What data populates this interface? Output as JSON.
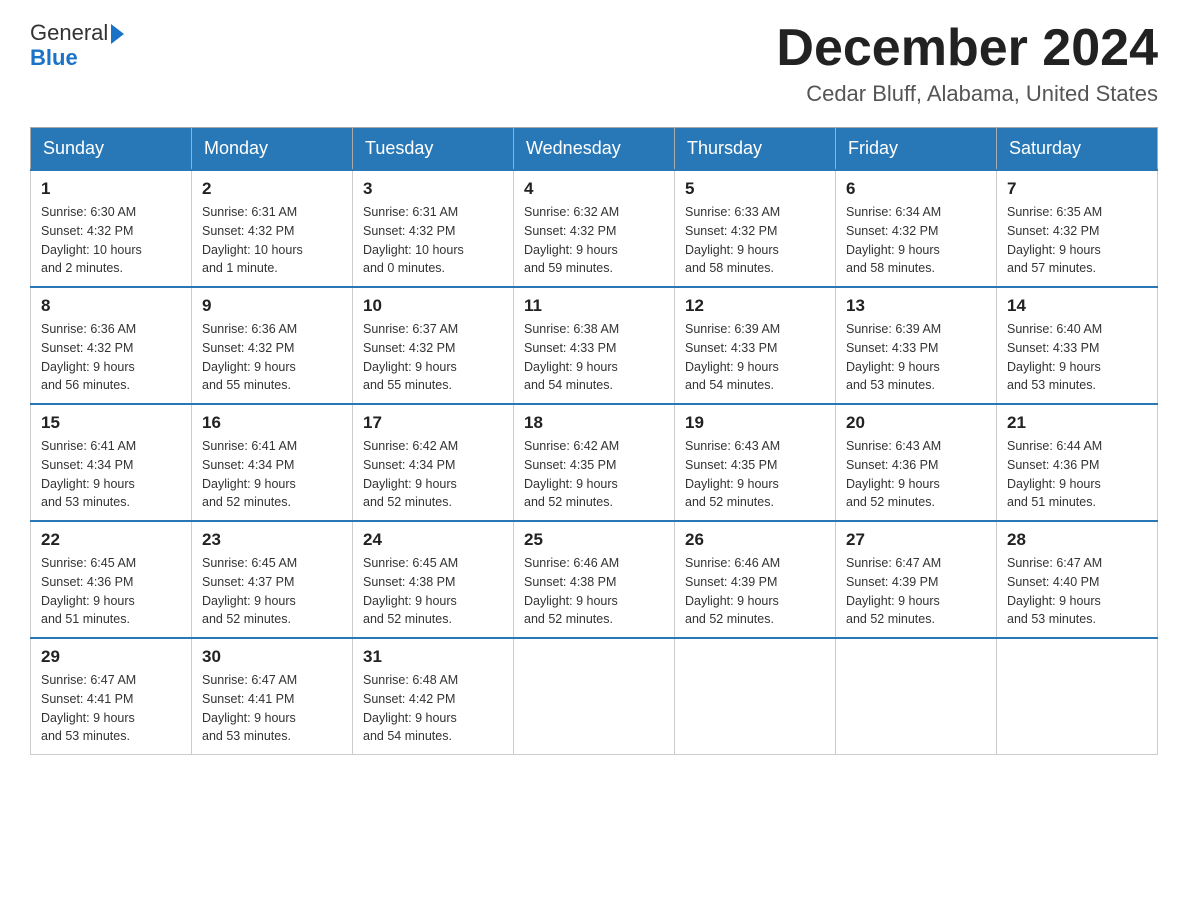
{
  "header": {
    "logo_general": "General",
    "logo_blue": "Blue",
    "month_title": "December 2024",
    "location": "Cedar Bluff, Alabama, United States"
  },
  "days_of_week": [
    "Sunday",
    "Monday",
    "Tuesday",
    "Wednesday",
    "Thursday",
    "Friday",
    "Saturday"
  ],
  "weeks": [
    [
      {
        "day": "1",
        "sunrise": "6:30 AM",
        "sunset": "4:32 PM",
        "daylight": "10 hours and 2 minutes."
      },
      {
        "day": "2",
        "sunrise": "6:31 AM",
        "sunset": "4:32 PM",
        "daylight": "10 hours and 1 minute."
      },
      {
        "day": "3",
        "sunrise": "6:31 AM",
        "sunset": "4:32 PM",
        "daylight": "10 hours and 0 minutes."
      },
      {
        "day": "4",
        "sunrise": "6:32 AM",
        "sunset": "4:32 PM",
        "daylight": "9 hours and 59 minutes."
      },
      {
        "day": "5",
        "sunrise": "6:33 AM",
        "sunset": "4:32 PM",
        "daylight": "9 hours and 58 minutes."
      },
      {
        "day": "6",
        "sunrise": "6:34 AM",
        "sunset": "4:32 PM",
        "daylight": "9 hours and 58 minutes."
      },
      {
        "day": "7",
        "sunrise": "6:35 AM",
        "sunset": "4:32 PM",
        "daylight": "9 hours and 57 minutes."
      }
    ],
    [
      {
        "day": "8",
        "sunrise": "6:36 AM",
        "sunset": "4:32 PM",
        "daylight": "9 hours and 56 minutes."
      },
      {
        "day": "9",
        "sunrise": "6:36 AM",
        "sunset": "4:32 PM",
        "daylight": "9 hours and 55 minutes."
      },
      {
        "day": "10",
        "sunrise": "6:37 AM",
        "sunset": "4:32 PM",
        "daylight": "9 hours and 55 minutes."
      },
      {
        "day": "11",
        "sunrise": "6:38 AM",
        "sunset": "4:33 PM",
        "daylight": "9 hours and 54 minutes."
      },
      {
        "day": "12",
        "sunrise": "6:39 AM",
        "sunset": "4:33 PM",
        "daylight": "9 hours and 54 minutes."
      },
      {
        "day": "13",
        "sunrise": "6:39 AM",
        "sunset": "4:33 PM",
        "daylight": "9 hours and 53 minutes."
      },
      {
        "day": "14",
        "sunrise": "6:40 AM",
        "sunset": "4:33 PM",
        "daylight": "9 hours and 53 minutes."
      }
    ],
    [
      {
        "day": "15",
        "sunrise": "6:41 AM",
        "sunset": "4:34 PM",
        "daylight": "9 hours and 53 minutes."
      },
      {
        "day": "16",
        "sunrise": "6:41 AM",
        "sunset": "4:34 PM",
        "daylight": "9 hours and 52 minutes."
      },
      {
        "day": "17",
        "sunrise": "6:42 AM",
        "sunset": "4:34 PM",
        "daylight": "9 hours and 52 minutes."
      },
      {
        "day": "18",
        "sunrise": "6:42 AM",
        "sunset": "4:35 PM",
        "daylight": "9 hours and 52 minutes."
      },
      {
        "day": "19",
        "sunrise": "6:43 AM",
        "sunset": "4:35 PM",
        "daylight": "9 hours and 52 minutes."
      },
      {
        "day": "20",
        "sunrise": "6:43 AM",
        "sunset": "4:36 PM",
        "daylight": "9 hours and 52 minutes."
      },
      {
        "day": "21",
        "sunrise": "6:44 AM",
        "sunset": "4:36 PM",
        "daylight": "9 hours and 51 minutes."
      }
    ],
    [
      {
        "day": "22",
        "sunrise": "6:45 AM",
        "sunset": "4:36 PM",
        "daylight": "9 hours and 51 minutes."
      },
      {
        "day": "23",
        "sunrise": "6:45 AM",
        "sunset": "4:37 PM",
        "daylight": "9 hours and 52 minutes."
      },
      {
        "day": "24",
        "sunrise": "6:45 AM",
        "sunset": "4:38 PM",
        "daylight": "9 hours and 52 minutes."
      },
      {
        "day": "25",
        "sunrise": "6:46 AM",
        "sunset": "4:38 PM",
        "daylight": "9 hours and 52 minutes."
      },
      {
        "day": "26",
        "sunrise": "6:46 AM",
        "sunset": "4:39 PM",
        "daylight": "9 hours and 52 minutes."
      },
      {
        "day": "27",
        "sunrise": "6:47 AM",
        "sunset": "4:39 PM",
        "daylight": "9 hours and 52 minutes."
      },
      {
        "day": "28",
        "sunrise": "6:47 AM",
        "sunset": "4:40 PM",
        "daylight": "9 hours and 53 minutes."
      }
    ],
    [
      {
        "day": "29",
        "sunrise": "6:47 AM",
        "sunset": "4:41 PM",
        "daylight": "9 hours and 53 minutes."
      },
      {
        "day": "30",
        "sunrise": "6:47 AM",
        "sunset": "4:41 PM",
        "daylight": "9 hours and 53 minutes."
      },
      {
        "day": "31",
        "sunrise": "6:48 AM",
        "sunset": "4:42 PM",
        "daylight": "9 hours and 54 minutes."
      },
      null,
      null,
      null,
      null
    ]
  ],
  "labels": {
    "sunrise": "Sunrise:",
    "sunset": "Sunset:",
    "daylight": "Daylight:"
  }
}
